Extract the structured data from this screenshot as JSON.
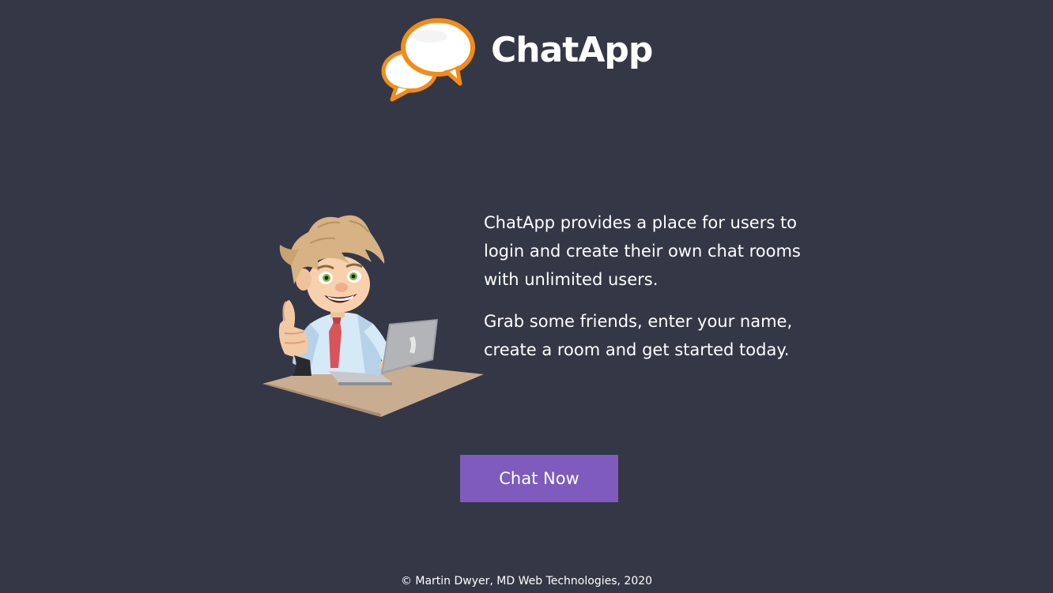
{
  "header": {
    "logo_icon": "chat-bubbles-icon",
    "brand_name": "ChatApp"
  },
  "hero": {
    "illustration": "man-at-laptop-illustration",
    "paragraph_1": "ChatApp provides a place for users to login and create their own chat rooms with unlimited users.",
    "paragraph_2": "Grab some friends, enter your name, create a room and get started today."
  },
  "cta": {
    "label": "Chat Now"
  },
  "footer": {
    "copyright": "© Martin Dwyer, MD Web Technologies, 2020"
  },
  "colors": {
    "background": "#343746",
    "button": "#7e5bbd",
    "logo_orange": "#f28c17",
    "text": "#ffffff"
  }
}
